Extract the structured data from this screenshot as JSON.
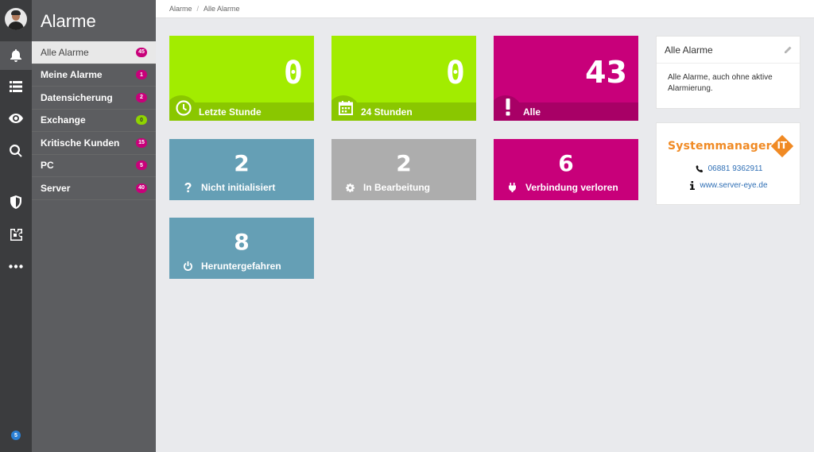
{
  "rail": {
    "items": [
      {
        "name": "bell-icon",
        "active": true
      },
      {
        "name": "list-icon",
        "active": false
      },
      {
        "name": "eye-icon",
        "active": false
      },
      {
        "name": "search-icon",
        "active": false
      },
      {
        "name": "shield-icon",
        "active": false
      },
      {
        "name": "puzzle-icon",
        "active": false
      },
      {
        "name": "more-icon",
        "active": false
      }
    ],
    "bottom_badge": "5"
  },
  "nav": {
    "title": "Alarme",
    "items": [
      {
        "label": "Alle Alarme",
        "count": "45",
        "active": true
      },
      {
        "label": "Meine Alarme",
        "count": "1"
      },
      {
        "label": "Datensicherung",
        "count": "2"
      },
      {
        "label": "Exchange",
        "count": "0"
      },
      {
        "label": "Kritische Kunden",
        "count": "15"
      },
      {
        "label": "PC",
        "count": "5"
      },
      {
        "label": "Server",
        "count": "40"
      }
    ]
  },
  "breadcrumb": [
    "Alarme",
    "Alle Alarme"
  ],
  "tiles": {
    "last_hour": {
      "value": "0",
      "label": "Letzte Stunde",
      "icon": "clock-icon"
    },
    "h24": {
      "value": "0",
      "label": "24 Stunden",
      "icon": "calendar-icon"
    },
    "all": {
      "value": "43",
      "label": "Alle",
      "icon": "exclamation-icon"
    },
    "not_initialized": {
      "value": "2",
      "label": "Nicht initialisiert",
      "icon": "question-icon"
    },
    "in_progress": {
      "value": "2",
      "label": "In Bearbeitung",
      "icon": "gear-icon"
    },
    "connection_lost": {
      "value": "6",
      "label": "Verbindung verloren",
      "icon": "plug-icon"
    },
    "shutdown": {
      "value": "8",
      "label": "Heruntergefahren",
      "icon": "power-icon"
    }
  },
  "info_card": {
    "title": "Alle Alarme",
    "description": "Alle Alarme, auch ohne aktive Alarmierung."
  },
  "brand": {
    "logo_text": "Systemmanager",
    "logo_badge": "IT",
    "phone": "06881 9362911",
    "website": "www.server-eye.de"
  },
  "colors": {
    "lime": "#a2ec00",
    "magenta": "#c8007a",
    "steel": "#659fb5",
    "gray": "#adadad",
    "brand_orange": "#f08a24"
  }
}
